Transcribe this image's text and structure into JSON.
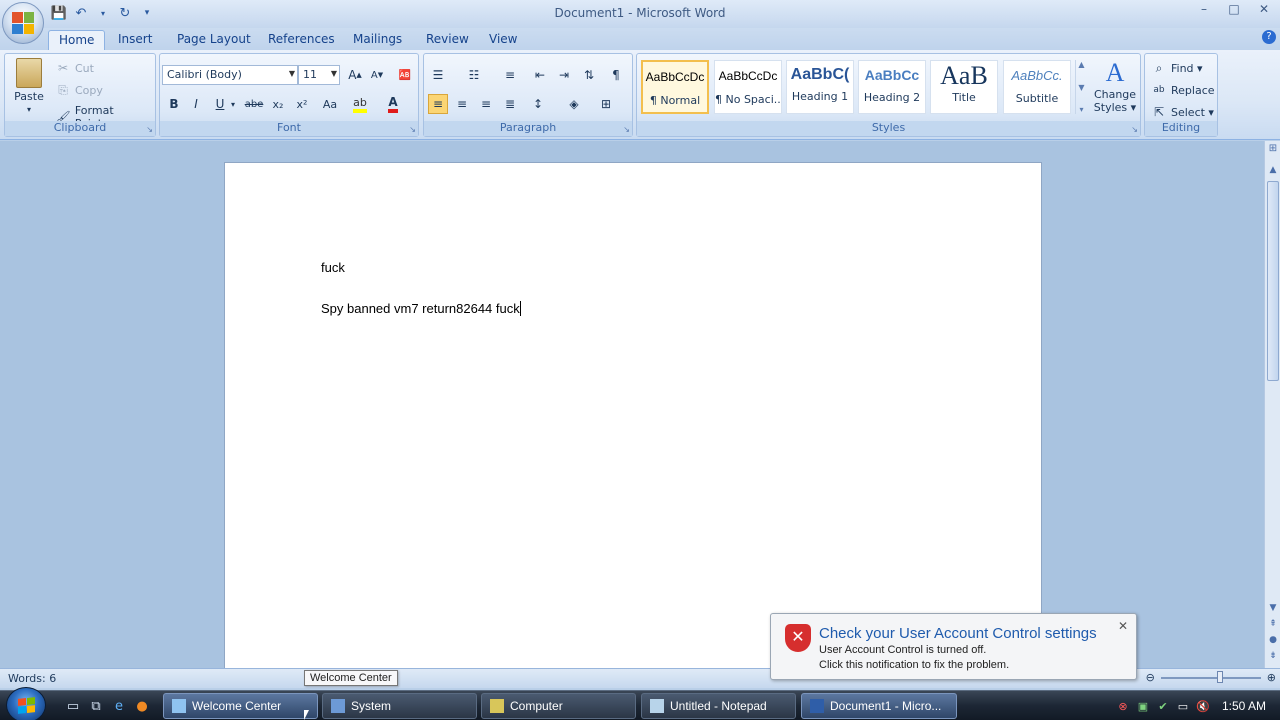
{
  "window": {
    "title": "Document1 - Microsoft Word",
    "controls": {
      "minimize": "–",
      "maximize": "□",
      "close": "✕"
    }
  },
  "ribbon_tabs": [
    "Home",
    "Insert",
    "Page Layout",
    "References",
    "Mailings",
    "Review",
    "View"
  ],
  "clipboard": {
    "label": "Clipboard",
    "paste": "Paste",
    "cut": "Cut",
    "copy": "Copy",
    "format_painter": "Format Painter"
  },
  "font": {
    "label": "Font",
    "font_name": "Calibri (Body)",
    "font_size": "11",
    "bold": "B",
    "italic": "I",
    "underline": "U",
    "strike": "abe",
    "subscript": "x₂",
    "superscript": "x²",
    "change_case": "Aa"
  },
  "paragraph": {
    "label": "Paragraph"
  },
  "styles": {
    "label": "Styles",
    "items": [
      {
        "preview": "AaBbCcDc",
        "name": "¶ Normal"
      },
      {
        "preview": "AaBbCcDc",
        "name": "¶ No Spaci..."
      },
      {
        "preview": "AaBbC(",
        "name": "Heading 1"
      },
      {
        "preview": "AaBbCc",
        "name": "Heading 2"
      },
      {
        "preview": "AaB",
        "name": "Title"
      },
      {
        "preview": "AaBbCc.",
        "name": "Subtitle"
      }
    ],
    "change_styles": [
      "Change",
      "Styles ▾"
    ]
  },
  "editing": {
    "label": "Editing",
    "find": "Find ▾",
    "replace": "Replace",
    "select": "Select ▾"
  },
  "document": {
    "paragraphs": [
      "fuck",
      "Spy banned vm7 return82644 fuck"
    ]
  },
  "statusbar": {
    "words": "Words: 6"
  },
  "notification": {
    "title": "Check your User Account Control settings",
    "line1": "User Account Control is turned off.",
    "line2": "Click this notification to fix the problem."
  },
  "tooltip": "Welcome Center",
  "taskbar": {
    "items": [
      "Welcome Center",
      "System",
      "Computer",
      "Untitled - Notepad",
      "Document1 - Micro..."
    ],
    "clock": "1:50 AM"
  },
  "colors": {
    "accent": "#15428b",
    "selected_style": "#f3bf4e",
    "notify_title": "#1f5bad"
  }
}
